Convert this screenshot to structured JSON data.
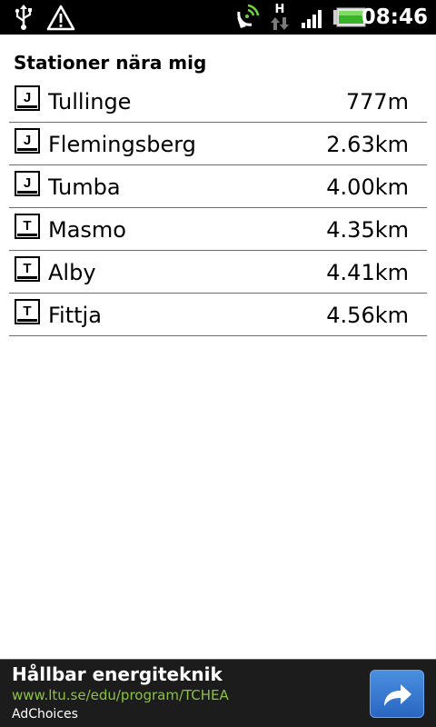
{
  "statusbar": {
    "time": "08:46",
    "icons": [
      "usb-icon",
      "warning-icon",
      "gps-icon",
      "network-hspa-icon",
      "signal-icon",
      "battery-icon"
    ],
    "network_label": "H"
  },
  "page": {
    "title": "Stationer nära mig"
  },
  "stations": [
    {
      "icon": "J",
      "name": "Tullinge",
      "distance": "777m"
    },
    {
      "icon": "J",
      "name": "Flemingsberg",
      "distance": "2.63km"
    },
    {
      "icon": "J",
      "name": "Tumba",
      "distance": "4.00km"
    },
    {
      "icon": "T",
      "name": "Masmo",
      "distance": "4.35km"
    },
    {
      "icon": "T",
      "name": "Alby",
      "distance": "4.41km"
    },
    {
      "icon": "T",
      "name": "Fittja",
      "distance": "4.56km"
    }
  ],
  "ad": {
    "title": "Hållbar energiteknik",
    "url": "www.ltu.se/edu/program/TCHEA",
    "choices": "AdChoices"
  },
  "colors": {
    "statusbar_bg": "#000000",
    "ad_bg": "#1c1c1c",
    "ad_url": "#8dc045",
    "ad_button": "#2966c2"
  }
}
